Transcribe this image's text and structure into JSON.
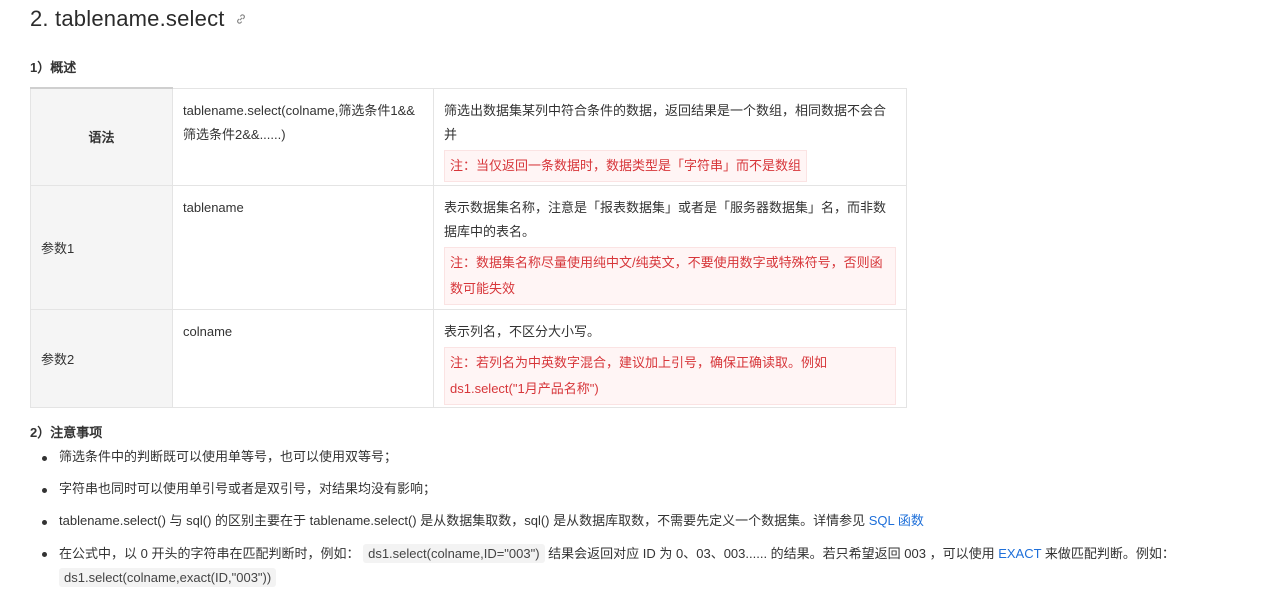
{
  "heading": {
    "text": "2. tablename.select"
  },
  "overview_title": "1）概述",
  "table": {
    "rows": [
      {
        "label": "语法",
        "code": "tablename.select(colname,筛选条件1&&筛选条件2&&......)",
        "desc": "筛选出数据集某列中符合条件的数据，返回结果是一个数组，相同数据不会合并",
        "note": "注：当仅返回一条数据时，数据类型是「字符串」而不是数组"
      },
      {
        "label": "参数1",
        "code": "tablename",
        "desc": "表示数据集名称，注意是「报表数据集」或者是「服务器数据集」名，而非数据库中的表名。",
        "note": "注：数据集名称尽量使用纯中文/纯英文，不要使用数字或特殊符号，否则函数可能失效"
      },
      {
        "label": "参数2",
        "code": "colname",
        "desc": "表示列名，不区分大小写。",
        "note": "注：若列名为中英数字混合，建议加上引号，确保正确读取。例如ds1.select(\"1月产品名称\")"
      }
    ]
  },
  "notes_title": "2）注意事项",
  "notes": {
    "item1": "筛选条件中的判断既可以使用单等号，也可以使用双等号；",
    "item2": "字符串也同时可以使用单引号或者是双引号，对结果均没有影响；",
    "item3_text": "tablename.select() 与 sql() 的区别主要在于 tablename.select() 是从数据集取数，sql() 是从数据库取数，不需要先定义一个数据集。详情参见 ",
    "item3_link": "SQL 函数",
    "item4_a": "在公式中，以 0 开头的字符串在匹配判断时，例如：",
    "item4_code1": "ds1.select(colname,ID=\"003\")",
    "item4_b": " 结果会返回对应 ID 为 0、03、003...... 的结果。若只希望返回 003 ，可以使用 ",
    "item4_link": "EXACT",
    "item4_c": " 来做匹配判断。例如：",
    "item4_code2": "ds1.select(colname,exact(ID,\"003\"))"
  },
  "colors": {
    "link": "#1e6fd9",
    "note_text": "#d7363a",
    "note_bg": "#fff5f5"
  },
  "icons": {
    "heading_anchor": "link-icon"
  }
}
